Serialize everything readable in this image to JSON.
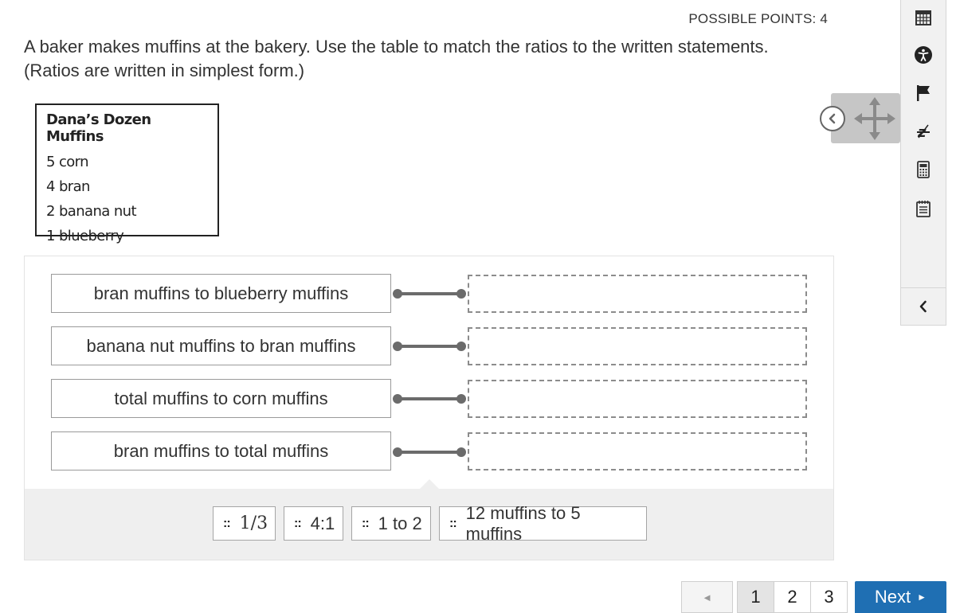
{
  "header": {
    "possible_points": "POSSIBLE POINTS: 4"
  },
  "question": {
    "text": "A baker makes muffins at the bakery. Use the table to match the ratios to the written statements.  (Ratios are written in simplest form.)"
  },
  "table": {
    "title": "Dana’s Dozen Muffins",
    "rows": [
      "5 corn",
      "4 bran",
      "2 banana nut",
      "1 blueberry"
    ]
  },
  "statements": [
    "bran muffins to blueberry muffins",
    "banana nut muffins to bran muffins",
    "total muffins to corn muffins",
    "bran muffins to total muffins"
  ],
  "answers": [
    "1/3",
    "4:1",
    "1 to 2",
    "12 muffins to 5 muffins"
  ],
  "answer_grip_icon": "grip-dots-icon",
  "toolbar": {
    "icons": [
      "calendar-icon",
      "accessibility-icon",
      "flag-icon",
      "strikethrough-icon",
      "calculator-icon",
      "notepad-icon",
      "chevron-left-icon"
    ]
  },
  "move_widget": {
    "icons": [
      "collapse-circle-icon",
      "move-arrows-icon"
    ]
  },
  "pagination": {
    "prev_icon": "◄",
    "pages": [
      "1",
      "2",
      "3"
    ],
    "current": "1",
    "next_label": "Next",
    "next_icon": "►"
  },
  "colors": {
    "next_button": "#1f6fb3",
    "connector": "#6b6b6b",
    "tray": "#efefef"
  }
}
